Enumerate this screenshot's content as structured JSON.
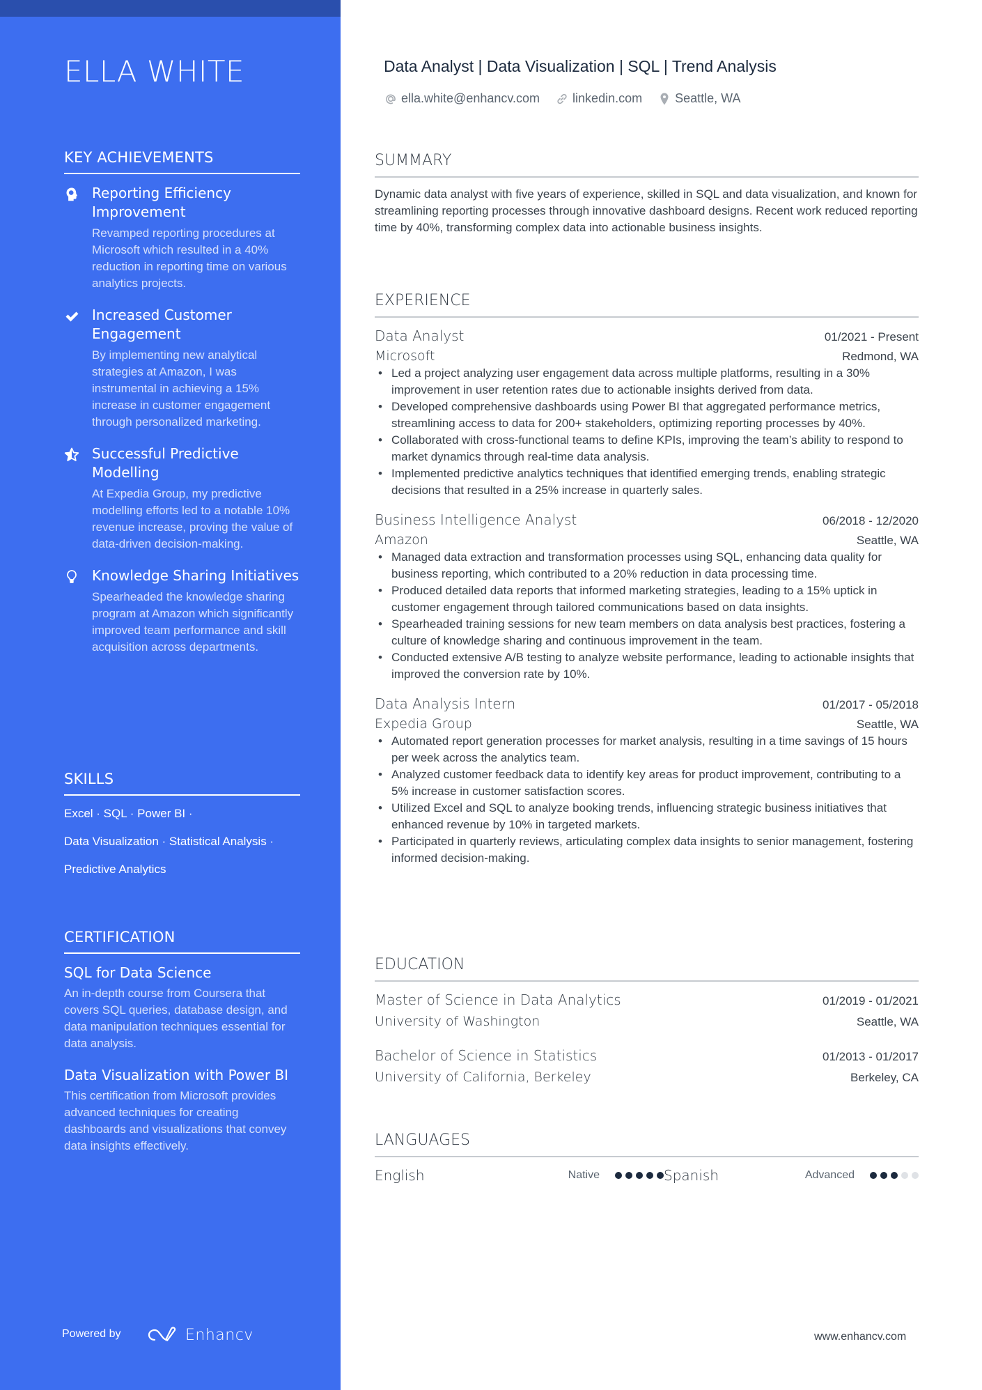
{
  "sidebar": {
    "name": "ELLA WHITE",
    "achievements_title": "KEY ACHIEVEMENTS",
    "achievements": [
      {
        "icon": "head-icon",
        "title": "Reporting Efficiency Improvement",
        "desc": "Revamped reporting procedures at Microsoft which resulted in a 40% reduction in reporting time on various analytics projects."
      },
      {
        "icon": "check-icon",
        "title": "Increased Customer Engagement",
        "desc": "By implementing new analytical strategies at Amazon, I was instrumental in achieving a 15% increase in customer engagement through personalized marketing."
      },
      {
        "icon": "star-half-icon",
        "title": "Successful Predictive Modelling",
        "desc": "At Expedia Group, my predictive modelling efforts led to a notable 10% revenue increase, proving the value of data-driven decision-making."
      },
      {
        "icon": "lightbulb-icon",
        "title": "Knowledge Sharing Initiatives",
        "desc": "Spearheaded the knowledge sharing program at Amazon which significantly improved team performance and skill acquisition across departments."
      }
    ],
    "skills_title": "SKILLS",
    "skills_lines": [
      "Excel · SQL · Power BI ·",
      "Data Visualization · Statistical Analysis ·",
      "Predictive Analytics"
    ],
    "certification_title": "CERTIFICATION",
    "certifications": [
      {
        "title": "SQL for Data Science",
        "desc": "An in-depth course from Coursera that covers SQL queries, database design, and data manipulation techniques essential for data analysis."
      },
      {
        "title": "Data Visualization with Power BI",
        "desc": "This certification from Microsoft provides advanced techniques for creating dashboards and visualizations that convey data insights effectively."
      }
    ],
    "powered_by": "Powered by",
    "brand": "Enhancv"
  },
  "header": {
    "headline": "Data Analyst | Data Visualization | SQL | Trend Analysis",
    "email": "ella.white@enhancv.com",
    "linkedin": "linkedin.com",
    "location": "Seattle, WA"
  },
  "summary": {
    "title": "SUMMARY",
    "text": "Dynamic data analyst with five years of experience, skilled in SQL and data visualization, and known for streamlining reporting processes through innovative dashboard designs. Recent work reduced reporting time by 40%, transforming complex data into actionable business insights."
  },
  "experience": {
    "title": "EXPERIENCE",
    "jobs": [
      {
        "title": "Data Analyst",
        "dates": "01/2021 - Present",
        "company": "Microsoft",
        "location": "Redmond, WA",
        "bullets": [
          "Led a project analyzing user engagement data across multiple platforms, resulting in a 30% improvement in user retention rates due to actionable insights derived from data.",
          "Developed comprehensive dashboards using Power BI that aggregated performance metrics, streamlining access to data for 200+ stakeholders, optimizing reporting processes by 40%.",
          "Collaborated with cross-functional teams to define KPIs, improving the team’s ability to respond to market dynamics through real-time data analysis.",
          "Implemented predictive analytics techniques that identified emerging trends, enabling strategic decisions that resulted in a 25% increase in quarterly sales."
        ]
      },
      {
        "title": "Business Intelligence Analyst",
        "dates": "06/2018 - 12/2020",
        "company": "Amazon",
        "location": "Seattle, WA",
        "bullets": [
          "Managed data extraction and transformation processes using SQL, enhancing data quality for business reporting, which contributed to a 20% reduction in data processing time.",
          "Produced detailed data reports that informed marketing strategies, leading to a 15% uptick in customer engagement through tailored communications based on data insights.",
          "Spearheaded training sessions for new team members on data analysis best practices, fostering a culture of knowledge sharing and continuous improvement in the team.",
          "Conducted extensive A/B testing to analyze website performance, leading to actionable insights that improved the conversion rate by 10%."
        ]
      },
      {
        "title": "Data Analysis Intern",
        "dates": "01/2017 - 05/2018",
        "company": "Expedia Group",
        "location": "Seattle, WA",
        "bullets": [
          "Automated report generation processes for market analysis, resulting in a time savings of 15 hours per week across the analytics team.",
          "Analyzed customer feedback data to identify key areas for product improvement, contributing to a 5% increase in customer satisfaction scores.",
          "Utilized Excel and SQL to analyze booking trends, influencing strategic business initiatives that enhanced revenue by 10% in targeted markets.",
          "Participated in quarterly reviews, articulating complex data insights to senior management, fostering informed decision-making."
        ]
      }
    ]
  },
  "education": {
    "title": "EDUCATION",
    "items": [
      {
        "degree": "Master of Science in Data Analytics",
        "dates": "01/2019 - 01/2021",
        "school": "University of Washington",
        "location": "Seattle, WA"
      },
      {
        "degree": "Bachelor of Science in Statistics",
        "dates": "01/2013 - 01/2017",
        "school": "University of California, Berkeley",
        "location": "Berkeley, CA"
      }
    ]
  },
  "languages": {
    "title": "LANGUAGES",
    "items": [
      {
        "name": "English",
        "level": "Native",
        "rating": 5,
        "max": 5
      },
      {
        "name": "Spanish",
        "level": "Advanced",
        "rating": 3,
        "max": 5
      }
    ]
  },
  "footer": {
    "website": "www.enhancv.com"
  },
  "colors": {
    "sidebar": "#3d6ef0",
    "sidebar_top": "#2a4fad",
    "dot_on": "#1c2a3e",
    "dot_off": "#dfe2e6"
  }
}
